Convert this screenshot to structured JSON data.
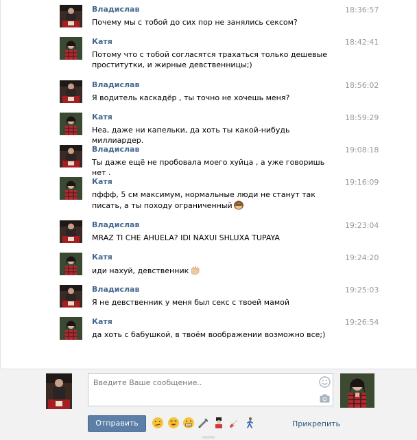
{
  "messages": [
    {
      "sender": "Владислав",
      "avatar": "vladislav",
      "time": "18:36:57",
      "text": "Почему мы с тобой до сих пор не занялись сексом?"
    },
    {
      "sender": "Катя",
      "avatar": "katya",
      "time": "18:42:41",
      "text": "Потому что с тобой согласятся трахаться только дешевые проститутки, и жирные девственницы;)"
    },
    {
      "sender": "Владислав",
      "avatar": "vladislav",
      "time": "18:56:02",
      "text": "Я водитель каскадёр , ты точно не хочешь меня?"
    },
    {
      "sender": "Катя",
      "avatar": "katya",
      "time": "18:59:29",
      "text": "Неа, даже ни капельки, да хоть ты какой-нибудь миллиардер."
    },
    {
      "sender": "Владислав",
      "avatar": "vladislav",
      "time": "19:08:18",
      "text": "Ты даже ещё не пробовала моего хуйца , а уже говоришь нет ."
    },
    {
      "sender": "Катя",
      "avatar": "katya",
      "time": "19:16:09",
      "text": "пффф, 5 см максимум, нормальные люди не станут так писать, а ты походу ограниченный",
      "emoji": "monkey-emoji"
    },
    {
      "sender": "Владислав",
      "avatar": "vladislav",
      "time": "19:23:04",
      "text": "MRAZ TI CHE AHUELA? IDI NAXUI SHLUXA TUPAYA"
    },
    {
      "sender": "Катя",
      "avatar": "katya",
      "time": "19:24:20",
      "text": "иди нахуй, девственник",
      "emoji": "waving-hand-emoji"
    },
    {
      "sender": "Владислав",
      "avatar": "vladislav",
      "time": "19:25:03",
      "text": "Я не девственник у меня был секс с твоей мамой"
    },
    {
      "sender": "Катя",
      "avatar": "katya",
      "time": "19:26:54",
      "text": "да хоть с бабушкой, в твоём воображении возможно все;)"
    }
  ],
  "compose": {
    "placeholder": "Введите Ваше сообщение..",
    "send_label": "Отправить",
    "attach_label": "Прикрепить",
    "emoji_shortcuts": [
      "confused-face",
      "grinning-face",
      "grimacing-face",
      "syringe",
      "guardsman",
      "pill",
      "walking-person"
    ]
  },
  "colors": {
    "name": "#45688e",
    "time": "#999999",
    "button": "#5b7fa6",
    "link": "#2b587a"
  }
}
